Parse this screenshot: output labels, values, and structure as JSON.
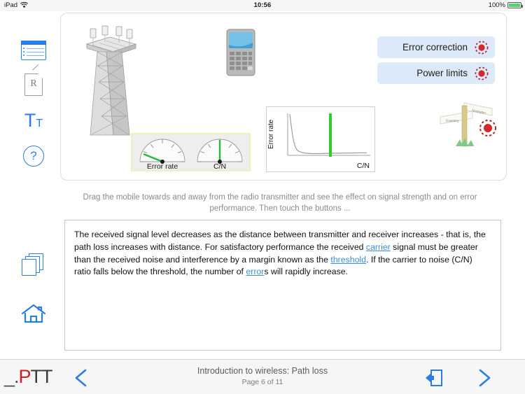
{
  "status_bar": {
    "device": "iPad",
    "wifi_icon": "wifi-icon",
    "time": "10:56",
    "battery_percent": "100%",
    "battery_color": "#4cd964"
  },
  "sidebar": {
    "items": [
      {
        "id": "contents",
        "icon": "contents-list-icon",
        "accent": "#2a7de1"
      },
      {
        "id": "reference",
        "icon": "reference-document-icon",
        "label": "R",
        "accent": "#9a9a9a"
      },
      {
        "id": "text-size",
        "icon": "text-size-icon",
        "big": "T",
        "small": "T",
        "accent": "#2a7de1"
      },
      {
        "id": "help",
        "icon": "help-question-icon",
        "label": "?",
        "accent": "#2a7de1"
      },
      {
        "id": "pages",
        "icon": "page-stack-icon",
        "accent": "#2a7de1"
      },
      {
        "id": "home",
        "icon": "home-icon",
        "accent": "#2a7de1"
      }
    ]
  },
  "animation": {
    "tower_label": "radio-transmitter-tower",
    "phone_label": "mobile-phone",
    "buttons": [
      {
        "label": "Error correction",
        "indicator": "red-led",
        "indicator_color": "#cc2222"
      },
      {
        "label": "Power limits",
        "indicator": "red-led",
        "indicator_color": "#cc2222"
      }
    ],
    "gauges": [
      {
        "label": "Error rate",
        "needle_angle_deg": -62,
        "needle_color": "#22bb33"
      },
      {
        "label": "C/N",
        "needle_angle_deg": 0,
        "needle_color": "#22bb33"
      }
    ],
    "signpost": {
      "sign_left": "Coventry",
      "sign_right": "Nuneaton",
      "indicator": "red-led",
      "indicator_color": "#cc2222"
    }
  },
  "chart_data": {
    "type": "line",
    "title": "",
    "xlabel": "C/N",
    "ylabel": "Error rate",
    "grid": false,
    "legend": false,
    "xlim": [
      0,
      100
    ],
    "ylim": [
      0,
      100
    ],
    "x": [
      2,
      4,
      6,
      8,
      10,
      12,
      14,
      16,
      18,
      20,
      25,
      30,
      40,
      50,
      60,
      70,
      80,
      90,
      96
    ],
    "y": [
      98,
      86,
      62,
      38,
      22,
      13,
      8,
      6,
      5,
      4.5,
      4,
      3.8,
      3.6,
      3.5,
      3.5,
      3.4,
      3.4,
      3.4,
      3.4
    ],
    "annotations": [
      {
        "type": "vline",
        "label": "C/N marker",
        "x": 52,
        "color": "#2ecc2e"
      }
    ]
  },
  "instruction": {
    "text": "Drag the mobile towards and away from the radio transmitter and see the effect on signal strength and on error performance. Then touch the buttons ..."
  },
  "body": {
    "segments": [
      {
        "type": "text",
        "value": "The received signal level decreases as the distance between transmitter and receiver increases - that is, the path loss increases with distance. For satisfactory performance the received "
      },
      {
        "type": "link",
        "value": "carrier"
      },
      {
        "type": "text",
        "value": " signal must be greater than the received noise and interference by a margin known as the "
      },
      {
        "type": "link",
        "value": "threshold"
      },
      {
        "type": "text",
        "value": ". If the carrier to noise (C/N) ratio falls below the threshold, the number of "
      },
      {
        "type": "link",
        "value": "error"
      },
      {
        "type": "text",
        "value": "s will rapidly increase."
      }
    ],
    "link_color": "#3a8ede"
  },
  "bottom_bar": {
    "logo": {
      "prefix": "_.",
      "accent": "P",
      "suffix": "TT",
      "accent_color": "#cc2026"
    },
    "prev_icon": "chevron-left-icon",
    "next_icon": "chevron-right-icon",
    "exit_icon": "exit-door-icon",
    "title": "Introduction to wireless: Path loss",
    "page_indicator": "Page 6 of 11"
  }
}
